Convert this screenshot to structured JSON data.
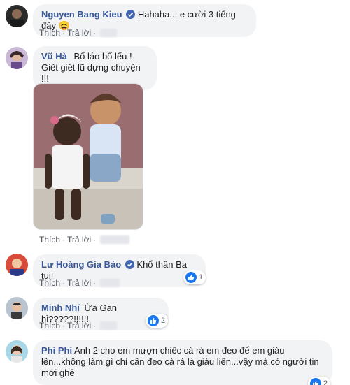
{
  "colors": {
    "name": "#385898",
    "bubble": "#f2f3f5",
    "verified": "#4267b2",
    "like": "#1877f2"
  },
  "actions": {
    "like_label": "Thích",
    "reply_label": "Trả lời",
    "separator": "·"
  },
  "comments": [
    {
      "author": "Nguyen Bang Kieu",
      "verified": true,
      "text": "Hahaha... e cười 3 tiếng đấy",
      "emoji": "😆"
    },
    {
      "author": "Vũ Hà",
      "verified": false,
      "line1": "Bố láo bố lếu !",
      "line2": "Giết giết lũ dựng chuyện !!!",
      "image": "baby-photo"
    },
    {
      "author": "Lư Hoàng Gia Bảo",
      "verified": true,
      "text": "Khổ thân Ba tui!",
      "reactions": "1"
    },
    {
      "author": "Minh Nhí",
      "verified": false,
      "text": "Ừa Gan hỉ?????!!!!!!",
      "reactions": "2"
    },
    {
      "author": "Phi Phi",
      "verified": false,
      "text": "Anh 2 cho em mượn chiếc cà rá em đeo để em giàu lên...không làm gì chỉ cần đeo cà rá là giàu liền...vậy mà có người tin mới ghê",
      "reactions": "2"
    }
  ]
}
